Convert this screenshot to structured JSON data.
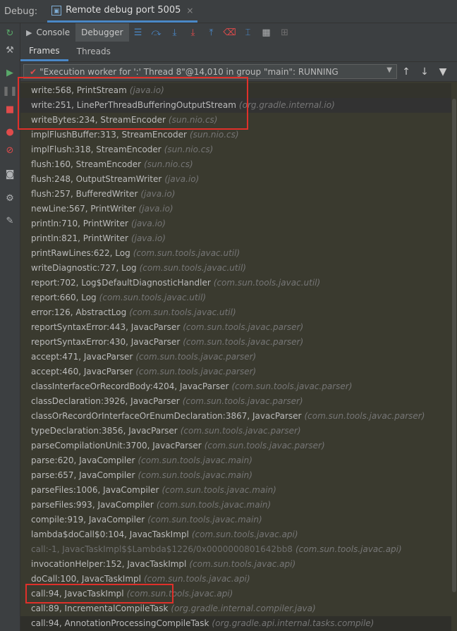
{
  "header": {
    "label": "Debug:",
    "tab_title": "Remote debug port 5005",
    "tab_close": "×"
  },
  "toolbar": {
    "console_label": "Console",
    "debugger_label": "Debugger"
  },
  "subtabs": {
    "frames": "Frames",
    "threads": "Threads"
  },
  "thread": {
    "selected": "\"Execution worker for ':' Thread 8\"@14,010 in group \"main\": RUNNING"
  },
  "frames": [
    {
      "frame": "write:568, PrintStream",
      "pkg": "(java.io)"
    },
    {
      "frame": "write:251, LinePerThreadBufferingOutputStream",
      "pkg": "(org.gradle.internal.io)"
    },
    {
      "frame": "writeBytes:234, StreamEncoder",
      "pkg": "(sun.nio.cs)"
    },
    {
      "frame": "implFlushBuffer:313, StreamEncoder",
      "pkg": "(sun.nio.cs)"
    },
    {
      "frame": "implFlush:318, StreamEncoder",
      "pkg": "(sun.nio.cs)"
    },
    {
      "frame": "flush:160, StreamEncoder",
      "pkg": "(sun.nio.cs)"
    },
    {
      "frame": "flush:248, OutputStreamWriter",
      "pkg": "(java.io)"
    },
    {
      "frame": "flush:257, BufferedWriter",
      "pkg": "(java.io)"
    },
    {
      "frame": "newLine:567, PrintWriter",
      "pkg": "(java.io)"
    },
    {
      "frame": "println:710, PrintWriter",
      "pkg": "(java.io)"
    },
    {
      "frame": "println:821, PrintWriter",
      "pkg": "(java.io)"
    },
    {
      "frame": "printRawLines:622, Log",
      "pkg": "(com.sun.tools.javac.util)"
    },
    {
      "frame": "writeDiagnostic:727, Log",
      "pkg": "(com.sun.tools.javac.util)"
    },
    {
      "frame": "report:702, Log$DefaultDiagnosticHandler",
      "pkg": "(com.sun.tools.javac.util)"
    },
    {
      "frame": "report:660, Log",
      "pkg": "(com.sun.tools.javac.util)"
    },
    {
      "frame": "error:126, AbstractLog",
      "pkg": "(com.sun.tools.javac.util)"
    },
    {
      "frame": "reportSyntaxError:443, JavacParser",
      "pkg": "(com.sun.tools.javac.parser)"
    },
    {
      "frame": "reportSyntaxError:430, JavacParser",
      "pkg": "(com.sun.tools.javac.parser)"
    },
    {
      "frame": "accept:471, JavacParser",
      "pkg": "(com.sun.tools.javac.parser)"
    },
    {
      "frame": "accept:460, JavacParser",
      "pkg": "(com.sun.tools.javac.parser)"
    },
    {
      "frame": "classInterfaceOrRecordBody:4204, JavacParser",
      "pkg": "(com.sun.tools.javac.parser)"
    },
    {
      "frame": "classDeclaration:3926, JavacParser",
      "pkg": "(com.sun.tools.javac.parser)"
    },
    {
      "frame": "classOrRecordOrInterfaceOrEnumDeclaration:3867, JavacParser",
      "pkg": "(com.sun.tools.javac.parser)"
    },
    {
      "frame": "typeDeclaration:3856, JavacParser",
      "pkg": "(com.sun.tools.javac.parser)"
    },
    {
      "frame": "parseCompilationUnit:3700, JavacParser",
      "pkg": "(com.sun.tools.javac.parser)"
    },
    {
      "frame": "parse:620, JavaCompiler",
      "pkg": "(com.sun.tools.javac.main)"
    },
    {
      "frame": "parse:657, JavaCompiler",
      "pkg": "(com.sun.tools.javac.main)"
    },
    {
      "frame": "parseFiles:1006, JavaCompiler",
      "pkg": "(com.sun.tools.javac.main)"
    },
    {
      "frame": "parseFiles:993, JavaCompiler",
      "pkg": "(com.sun.tools.javac.main)"
    },
    {
      "frame": "compile:919, JavaCompiler",
      "pkg": "(com.sun.tools.javac.main)"
    },
    {
      "frame": "lambda$doCall$0:104, JavacTaskImpl",
      "pkg": "(com.sun.tools.javac.api)"
    },
    {
      "frame": "call:-1, JavacTaskImpl$$Lambda$1226/0x0000000801642bb8",
      "pkg": "(com.sun.tools.javac.api)",
      "dim": true
    },
    {
      "frame": "invocationHelper:152, JavacTaskImpl",
      "pkg": "(com.sun.tools.javac.api)"
    },
    {
      "frame": "doCall:100, JavacTaskImpl",
      "pkg": "(com.sun.tools.javac.api)"
    },
    {
      "frame": "call:94, JavacTaskImpl",
      "pkg": "(com.sun.tools.javac.api)"
    },
    {
      "frame": "call:89, IncrementalCompileTask",
      "pkg": "(org.gradle.internal.compiler.java)"
    },
    {
      "frame": "call:94, AnnotationProcessingCompileTask",
      "pkg": "(org.gradle.api.internal.tasks.compile)"
    }
  ],
  "colors": {
    "highlight": "#e0302a",
    "accent": "#4a88c7"
  }
}
